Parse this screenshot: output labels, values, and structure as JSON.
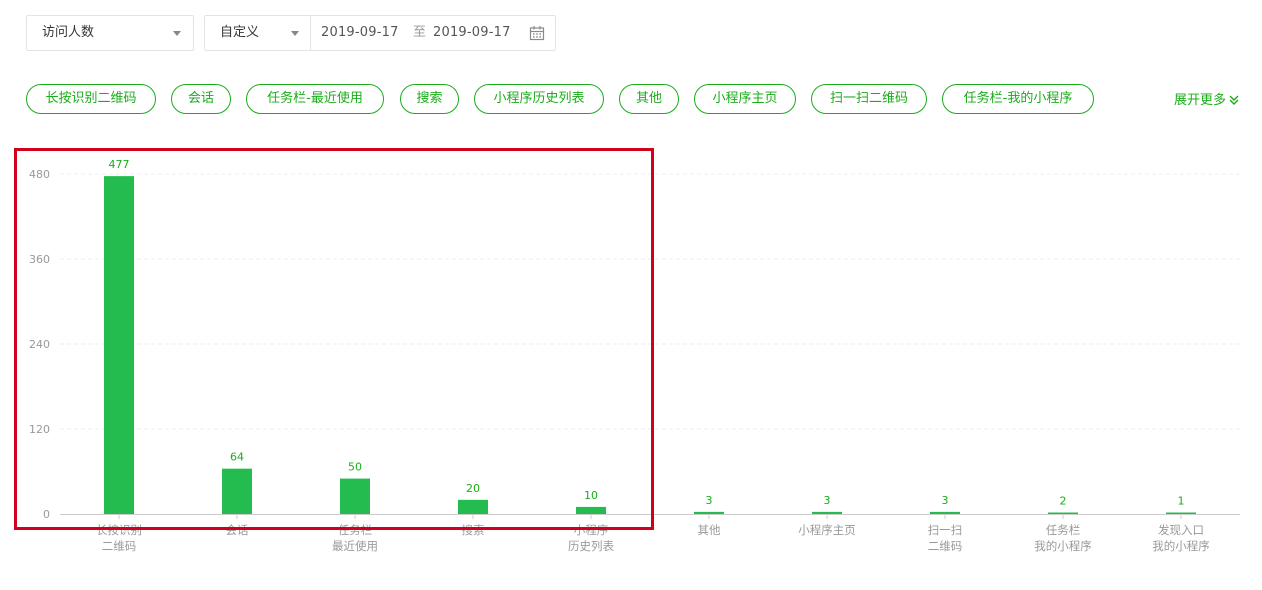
{
  "filters": {
    "metric_select": {
      "value": "访问人数"
    },
    "date_mode": {
      "value": "自定义"
    },
    "date_range": {
      "start": "2019-09-17",
      "separator": "至",
      "end": "2019-09-17"
    },
    "calendar_icon": "calendar-icon"
  },
  "source_tags": [
    "长按识别二维码",
    "会话",
    "任务栏-最近使用",
    "搜索",
    "小程序历史列表",
    "其他",
    "小程序主页",
    "扫一扫二维码",
    "任务栏-我的小程序"
  ],
  "expand_more": {
    "label": "展开更多",
    "icon": "double-chevron-down-icon"
  },
  "colors": {
    "accent": "#1aad19",
    "bar": "#24bc4e",
    "value_label": "#1aad19",
    "highlight": "#d0021b",
    "grid": "#ececec",
    "axis_text": "#999999"
  },
  "chart_data": {
    "type": "bar",
    "categories": [
      [
        "长按识别",
        "二维码"
      ],
      [
        "会话"
      ],
      [
        "任务栏",
        "最近使用"
      ],
      [
        "搜索"
      ],
      [
        "小程序",
        "历史列表"
      ],
      [
        "其他"
      ],
      [
        "小程序主页"
      ],
      [
        "扫一扫",
        "二维码"
      ],
      [
        "任务栏",
        "我的小程序"
      ],
      [
        "发现入口",
        "我的小程序"
      ]
    ],
    "values": [
      477,
      64,
      50,
      20,
      10,
      3,
      3,
      3,
      2,
      1
    ],
    "yticks": [
      0,
      120,
      240,
      360,
      480
    ],
    "ylim": [
      0,
      480
    ],
    "grid": true,
    "title": "",
    "xlabel": "",
    "ylabel": ""
  }
}
